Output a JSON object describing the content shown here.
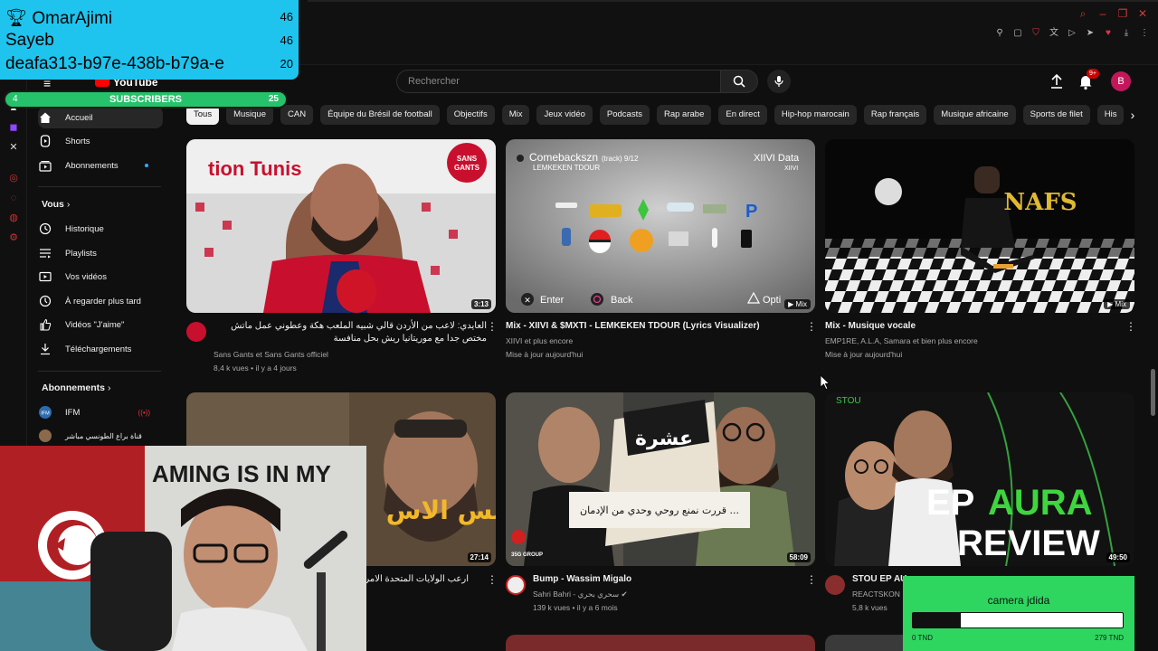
{
  "overlay": {
    "leaderboard": [
      {
        "name": "OmarAjimi",
        "count": "46"
      },
      {
        "name": "Sayeb",
        "count": "46"
      },
      {
        "name": "deafa313-b97e-438b-b79a-e",
        "count": "20"
      }
    ],
    "subscribers": {
      "label": "SUBSCRIBERS",
      "current": "4",
      "goal": "25"
    },
    "camera_goal": {
      "title": "camera jdida",
      "left": "0 TND",
      "right": "279 TND",
      "progress": 0.23
    }
  },
  "youtube": {
    "logo": "YouTube",
    "search": {
      "placeholder": "Rechercher"
    },
    "notifications_badge": "9+",
    "avatar_letter": "B",
    "chips": [
      "Tous",
      "Musique",
      "CAN",
      "Équipe du Brésil de football",
      "Objectifs",
      "Mix",
      "Jeux vidéo",
      "Podcasts",
      "Rap arabe",
      "En direct",
      "Hip-hop marocain",
      "Rap français",
      "Musique africaine",
      "Sports de filet",
      "His"
    ],
    "sidebar": {
      "main": [
        {
          "label": "Accueil",
          "icon": "home-icon"
        },
        {
          "label": "Shorts",
          "icon": "shorts-icon"
        },
        {
          "label": "Abonnements",
          "icon": "subscriptions-icon"
        }
      ],
      "you_header": "Vous",
      "you": [
        {
          "label": "Historique",
          "icon": "history-icon"
        },
        {
          "label": "Playlists",
          "icon": "playlists-icon"
        },
        {
          "label": "Vos vidéos",
          "icon": "your-videos-icon"
        },
        {
          "label": "À regarder plus tard",
          "icon": "watch-later-icon"
        },
        {
          "label": "Vidéos \"J'aime\"",
          "icon": "liked-icon"
        },
        {
          "label": "Téléchargements",
          "icon": "downloads-icon"
        }
      ],
      "subs_header": "Abonnements",
      "subs": [
        {
          "label": "IFM"
        },
        {
          "label": "قناة براع الطونسي مباشر"
        }
      ]
    },
    "videos": [
      {
        "title": "العايدي: لاعب من الأردن قالي شبيه الملعب هكة وعطوني عمل ماتش مختص جدا مع موريتانيا ريش بحل منافسة",
        "channel": "Sans Gants et Sans Gants officiel",
        "stats": "8,4 k vues • il y a 4 jours",
        "duration": "3:13",
        "thumb_badge": "SANS GANTS",
        "thumb_text": "tion Tunis"
      },
      {
        "title": "Mix - XIIVI & $MXTI - LEMKEKEN TDOUR (Lyrics Visualizer)",
        "channel": "XIIVI et plus encore",
        "stats": "Mise à jour aujourd'hui",
        "tag": "Mix",
        "thumb_top_left": "Comebackszn",
        "thumb_track": "(track) 9/12",
        "thumb_sub": "LEMKEKEN TDOUR",
        "thumb_top_right": "XIIVI Data",
        "thumb_top_right2": "XIIVI",
        "enter": "Enter",
        "back": "Back",
        "options": "Opti"
      },
      {
        "title": "Mix - Musique vocale",
        "channel": "EMP1RE, A.L.A, Samara et bien plus encore",
        "stats": "Mise à jour aujourd'hui",
        "tag": "Mix",
        "thumb_logo": "NAFS"
      },
      {
        "title": "ارعب الولايات المتحدة الامريكية",
        "duration": "27:14",
        "thumb_text": "الس الاس"
      },
      {
        "title": "Bump - Wassim Migalo",
        "channel": "Sahri Bahri - سحري بحري",
        "stats": "139 k vues • il y a 6 mois",
        "duration": "58:09",
        "thumb_title": "عشرة",
        "thumb_caption": "قررت نمنع روحي وحدي من الإدمان ...",
        "thumb_logo": "35G GROUP"
      },
      {
        "title": "STOU EP AU",
        "channel": "REACTSKON",
        "stats": "5,8 k vues",
        "duration": "49:50",
        "thumb_ep": "EP",
        "thumb_aura": "AURA",
        "thumb_review": "REVIEW",
        "thumb_stou": "STOU"
      }
    ]
  },
  "webcam_text": "AMING IS IN MY",
  "colors": {
    "accent_red": "#ff0000",
    "overlay_blue": "#1ec4ee",
    "overlay_green": "#2ed65f",
    "sub_green": "#26c26b"
  }
}
